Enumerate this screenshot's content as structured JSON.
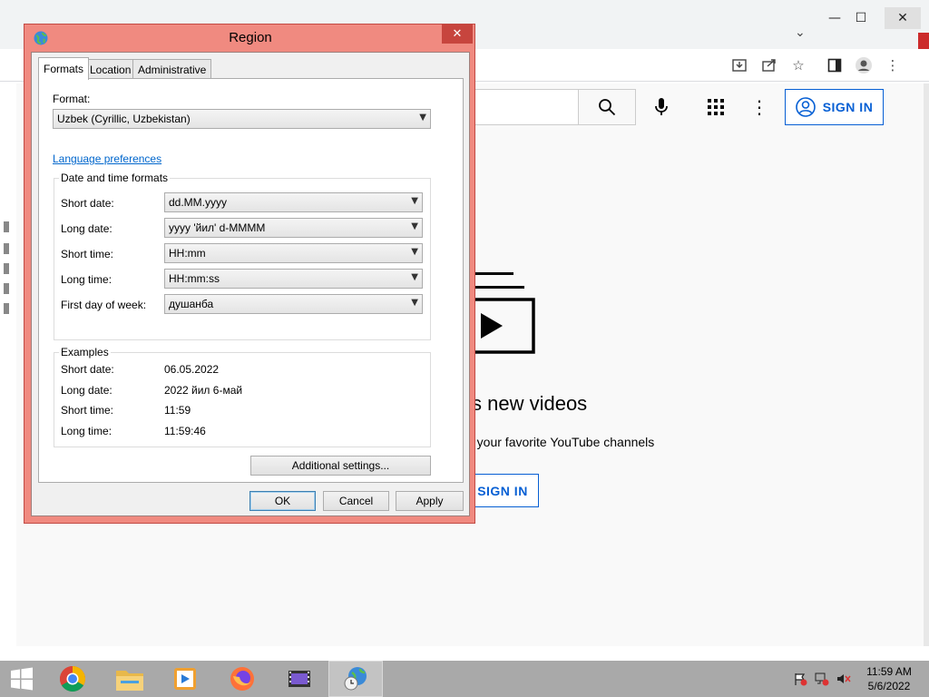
{
  "browser": {
    "window_controls": {
      "minimize": "—",
      "maximize": "☐",
      "close": "✕"
    },
    "youtube": {
      "sign_in_top": "SIGN IN",
      "heading": "s new videos",
      "subtext": "o your favorite YouTube channels",
      "sign_in_mid": "SIGN IN"
    }
  },
  "dialog": {
    "title": "Region",
    "close": "✕",
    "tabs": [
      "Formats",
      "Location",
      "Administrative"
    ],
    "format_label": "Format:",
    "format_value": "Uzbek (Cyrillic, Uzbekistan)",
    "language_link": "Language preferences",
    "date_time_group": "Date and time formats",
    "rows": [
      {
        "label": "Short date:",
        "value": "dd.MM.yyyy"
      },
      {
        "label": "Long date:",
        "value": "yyyy 'йил' d-MMMM"
      },
      {
        "label": "Short time:",
        "value": "HH:mm"
      },
      {
        "label": "Long time:",
        "value": "HH:mm:ss"
      },
      {
        "label": "First day of week:",
        "value": "душанба"
      }
    ],
    "examples_group": "Examples",
    "examples": [
      {
        "label": "Short date:",
        "value": "06.05.2022"
      },
      {
        "label": "Long date:",
        "value": "2022 йил 6-май"
      },
      {
        "label": "Short time:",
        "value": "11:59"
      },
      {
        "label": "Long time:",
        "value": "11:59:46"
      }
    ],
    "additional_settings": "Additional settings...",
    "ok": "OK",
    "cancel": "Cancel",
    "apply": "Apply"
  },
  "taskbar": {
    "time": "11:59 AM",
    "date": "5/6/2022"
  },
  "colors": {
    "dialog_frame": "#f08a80",
    "close_button": "#c7453e",
    "youtube_blue": "#065fd4",
    "taskbar": "#a9a9a9"
  }
}
